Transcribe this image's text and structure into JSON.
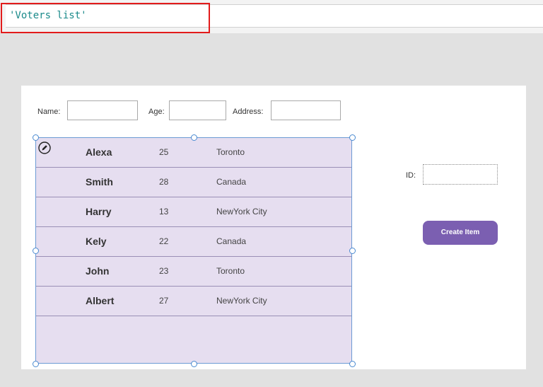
{
  "formula": {
    "value": "'Voters list'"
  },
  "form": {
    "name_label": "Name:",
    "age_label": "Age:",
    "address_label": "Address:",
    "id_label": "ID:",
    "create_button": "Create Item"
  },
  "gallery": {
    "rows": [
      {
        "name": "Alexa",
        "age": "25",
        "address": "Toronto"
      },
      {
        "name": "Smith",
        "age": "28",
        "address": "Canada"
      },
      {
        "name": "Harry",
        "age": "13",
        "address": "NewYork City"
      },
      {
        "name": "Kely",
        "age": "22",
        "address": "Canada"
      },
      {
        "name": "John",
        "age": "23",
        "address": "Toronto"
      },
      {
        "name": "Albert",
        "age": "27",
        "address": "NewYork City"
      }
    ]
  },
  "icons": {
    "edit": "pencil-icon"
  },
  "colors": {
    "button": "#7b5fb1",
    "gallery_bg": "#e6def0",
    "highlight": "#e21b1b",
    "formula_text": "#1a8a8a"
  }
}
